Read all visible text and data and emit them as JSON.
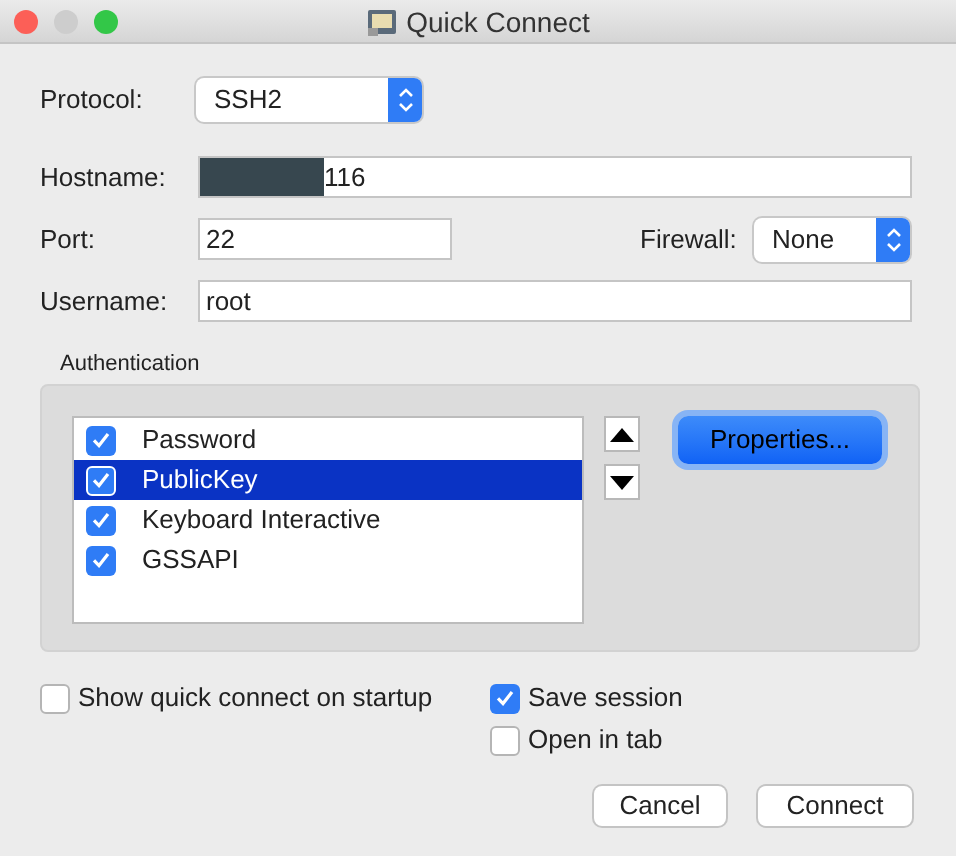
{
  "window": {
    "title": "Quick Connect"
  },
  "protocol": {
    "label": "Protocol:",
    "value": "SSH2"
  },
  "hostname": {
    "label": "Hostname:",
    "value": "116",
    "redacted": true
  },
  "port": {
    "label": "Port:",
    "value": "22"
  },
  "firewall": {
    "label": "Firewall:",
    "value": "None"
  },
  "username": {
    "label": "Username:",
    "value": "root"
  },
  "authentication": {
    "title": "Authentication",
    "methods": [
      {
        "label": "Password",
        "checked": true,
        "selected": false
      },
      {
        "label": "PublicKey",
        "checked": true,
        "selected": true
      },
      {
        "label": "Keyboard Interactive",
        "checked": true,
        "selected": false
      },
      {
        "label": "GSSAPI",
        "checked": true,
        "selected": false
      }
    ],
    "properties_button": "Properties..."
  },
  "options": [
    {
      "label": "Show quick connect on startup",
      "checked": false
    },
    {
      "label": "Save session",
      "checked": true
    },
    {
      "label": "Open in tab",
      "checked": false
    }
  ],
  "buttons": [
    "Cancel",
    "Connect"
  ]
}
